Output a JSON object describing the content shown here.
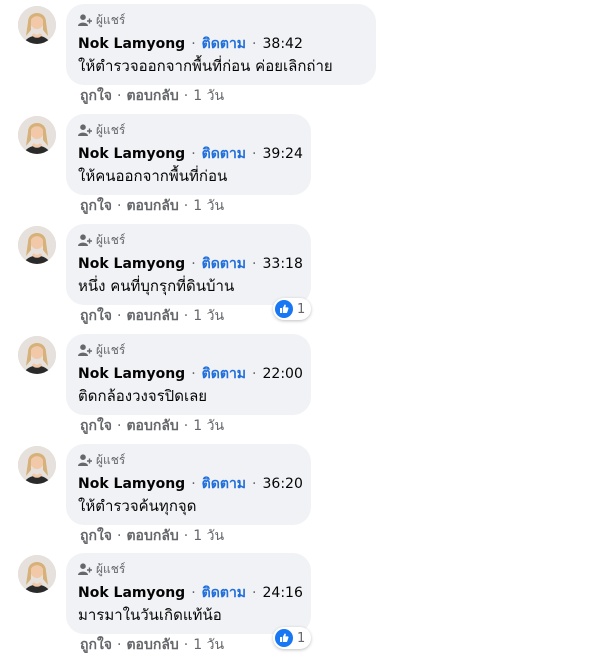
{
  "ui": {
    "badge_label": "ผู้แชร์",
    "follow_label": "ติดตาม",
    "like_label": "ถูกใจ",
    "reply_label": "ตอบกลับ",
    "dot": "·",
    "accent_color": "#216fdb",
    "bubble_color": "#f0f2f5",
    "icons": {
      "badge": "person-share-icon",
      "reaction": "like-thumb-icon"
    }
  },
  "comments": [
    {
      "author": "Nok Lamyong",
      "time": "38:42",
      "text": "ให้ตำรวจออกจากพื้นที่ก่อน ค่อยเลิกถ่าย",
      "age": "1 วัน",
      "reactions": null
    },
    {
      "author": "Nok Lamyong",
      "time": "39:24",
      "text": "ให้คนออกจากพื้นที่ก่อน",
      "age": "1 วัน",
      "reactions": null
    },
    {
      "author": "Nok Lamyong",
      "time": "33:18",
      "text": "หนึ่ง คนที่บุกรุกที่ดินบ้าน",
      "age": "1 วัน",
      "reactions": "1"
    },
    {
      "author": "Nok Lamyong",
      "time": "22:00",
      "text": "ติดกล้องวงจรปิดเลย",
      "age": "1 วัน",
      "reactions": null
    },
    {
      "author": "Nok Lamyong",
      "time": "36:20",
      "text": "ให้ตำรวจค้นทุกจุด",
      "age": "1 วัน",
      "reactions": null
    },
    {
      "author": "Nok Lamyong",
      "time": "24:16",
      "text": "มารมาในวันเกิดแท้น้อ",
      "age": "1 วัน",
      "reactions": "1"
    }
  ]
}
